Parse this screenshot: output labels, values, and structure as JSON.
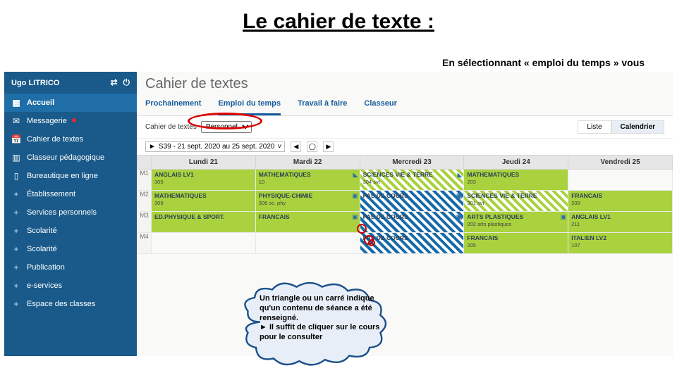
{
  "slide": {
    "title": "Le cahier de texte :"
  },
  "callout_top": "En sélectionnant « emploi du temps » vous avez une vision globale pour la semaine.",
  "callout_cloud": "Un triangle ou un carré indique qu'un contenu de séance a été renseigné.\n► Il suffit de cliquer sur le cours pour le consulter",
  "sidebar": {
    "user": "Ugo LITRICO",
    "items": [
      {
        "icon": "▦",
        "label": "Accueil",
        "selected": true
      },
      {
        "icon": "✉",
        "label": "Messagerie",
        "badge": true
      },
      {
        "icon": "📅",
        "label": "Cahier de textes"
      },
      {
        "icon": "▥",
        "label": "Classeur pédagogique"
      },
      {
        "icon": "▯",
        "label": "Bureautique en ligne"
      },
      {
        "icon": "+",
        "label": "Établissement",
        "plus": true
      },
      {
        "icon": "+",
        "label": "Services personnels",
        "plus": true
      },
      {
        "icon": "+",
        "label": "Scolarité",
        "plus": true
      },
      {
        "icon": "+",
        "label": "Scolarité",
        "plus": true
      },
      {
        "icon": "+",
        "label": "Publication",
        "plus": true
      },
      {
        "icon": "+",
        "label": "e-services",
        "plus": true
      },
      {
        "icon": "+",
        "label": "Espace des classes",
        "plus": true
      }
    ]
  },
  "main": {
    "title": "Cahier de textes",
    "tabs": [
      "Prochainement",
      "Emploi du temps",
      "Travail à faire",
      "Classeur"
    ],
    "active_tab": 1,
    "toolbar_label": "Cahier de textes",
    "toolbar_select": "Personnel",
    "view": {
      "liste": "Liste",
      "cal": "Calendrier"
    },
    "week_label": "S39 - 21 sept. 2020 au 25 sept. 2020",
    "days": [
      "Lundi 21",
      "Mardi 22",
      "Mercredi 23",
      "Jeudi 24",
      "Vendredi 25"
    ],
    "slots": [
      "M1",
      "M2",
      "M3",
      "M4"
    ],
    "cells": {
      "M1": [
        {
          "subj": "ANGLAIS LV1",
          "room": "305",
          "cls": "green"
        },
        {
          "subj": "MATHEMATIQUES",
          "room": "10",
          "cls": "green",
          "marker": "◣"
        },
        {
          "subj": "SCIENCES VIE & TERRE",
          "room": "304 svt",
          "cls": "hatch-green",
          "marker": "◣"
        },
        {
          "subj": "MATHEMATIQUES",
          "room": "203",
          "cls": "green"
        },
        {
          "subj": "",
          "room": "",
          "cls": ""
        }
      ],
      "M2": [
        {
          "subj": "MATHEMATIQUES",
          "room": "309",
          "cls": "green"
        },
        {
          "subj": "PHYSIQUE-CHIMIE",
          "room": "306 sc. phy",
          "cls": "green",
          "marker": "▣"
        },
        {
          "subj": "PAS DE COURS",
          "room": "",
          "cls": "hatch-blue noclass",
          "marker": "▣"
        },
        {
          "subj": "SCIENCES VIE & TERRE",
          "room": "301 svt",
          "cls": "hatch-green"
        },
        {
          "subj": "FRANCAIS",
          "room": "209",
          "cls": "green"
        }
      ],
      "M3": [
        {
          "subj": "ED.PHYSIQUE & SPORT.",
          "room": "",
          "cls": "green"
        },
        {
          "subj": "FRANCAIS",
          "room": "",
          "cls": "green",
          "marker": "▣"
        },
        {
          "subj": "PAS DE COURS",
          "room": "",
          "cls": "hatch-blue noclass",
          "marker": "▣"
        },
        {
          "subj": "ARTS PLASTIQUES",
          "room": "202 arts plastiques",
          "cls": "green",
          "marker": "▣"
        },
        {
          "subj": "ANGLAIS LV1",
          "room": "211",
          "cls": "green"
        }
      ],
      "M4": [
        {
          "subj": "",
          "room": "",
          "cls": ""
        },
        {
          "subj": "",
          "room": "",
          "cls": ""
        },
        {
          "subj": "PAS DE COURS",
          "room": "",
          "cls": "hatch-blue noclass"
        },
        {
          "subj": "FRANCAIS",
          "room": "205",
          "cls": "green"
        },
        {
          "subj": "ITALIEN LV2",
          "room": "107",
          "cls": "green"
        }
      ]
    }
  }
}
